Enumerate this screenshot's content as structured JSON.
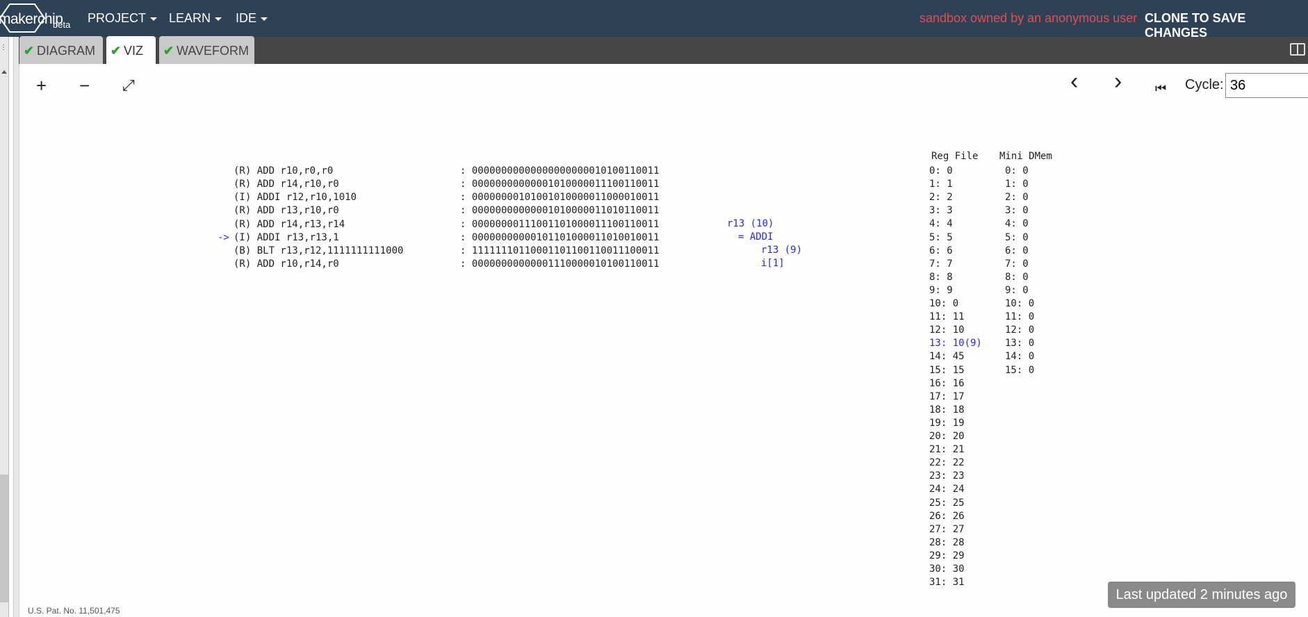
{
  "topbar": {
    "logo_text": "makerchip",
    "beta": "beta",
    "menus": [
      "PROJECT",
      "LEARN",
      "IDE"
    ],
    "sandbox_notice": "sandbox owned by an anonymous user",
    "clone_button": "CLONE TO SAVE CHANGES"
  },
  "tabs": [
    {
      "label": "DIAGRAM",
      "checked": true,
      "active": false
    },
    {
      "label": "VIZ",
      "checked": true,
      "active": true
    },
    {
      "label": "WAVEFORM",
      "checked": true,
      "active": false
    }
  ],
  "toolbar": {
    "zoom_in": "+",
    "zoom_out": "−",
    "fit": "⤢",
    "prev": "‹",
    "next": "›",
    "first": "⏮",
    "cycle_label": "Cycle:",
    "cycle_value": "36"
  },
  "viz": {
    "pc_arrow": "->",
    "instructions": [
      {
        "asm": "(R) ADD r10,r0,r0",
        "bits": ": 00000000000000000000010100110011"
      },
      {
        "asm": "(R) ADD r14,r10,r0",
        "bits": ": 00000000000001010000011100110011"
      },
      {
        "asm": "(I) ADDI r12,r10,1010",
        "bits": ": 00000000101001010000011000010011"
      },
      {
        "asm": "(R) ADD r13,r10,r0",
        "bits": ": 00000000000001010000011010110011"
      },
      {
        "asm": "(R) ADD r14,r13,r14",
        "bits": ": 00000000111001101000011100110011"
      },
      {
        "asm": "(I) ADDI r13,r13,1",
        "bits": ": 00000000000101101000011010010011"
      },
      {
        "asm": "(B) BLT r13,r12,1111111111000",
        "bits": ": 11111110110001101100110011100011"
      },
      {
        "asm": "(R) ADD r10,r14,r0",
        "bits": ": 00000000000001110000010100110011"
      }
    ],
    "explain": [
      "r13 (10)",
      "= ADDI",
      "r13 (9)",
      "i[1]"
    ],
    "reg_file_header": "Reg File",
    "mem_header": "Mini DMem",
    "registers": [
      "0: 0",
      "1: 1",
      "2: 2",
      "3: 3",
      "4: 4",
      "5: 5",
      "6: 6",
      "7: 7",
      "8: 8",
      "9: 9",
      "10: 0",
      "11: 11",
      "12: 10",
      "13: 10(9)",
      "14: 45",
      "15: 15",
      "16: 16",
      "17: 17",
      "18: 18",
      "19: 19",
      "20: 20",
      "21: 21",
      "22: 22",
      "23: 23",
      "24: 24",
      "25: 25",
      "26: 26",
      "27: 27",
      "28: 28",
      "29: 29",
      "30: 30",
      "31: 31"
    ],
    "highlighted_register": 13,
    "memory": [
      "0: 0",
      "1: 0",
      "2: 0",
      "3: 0",
      "4: 0",
      "5: 0",
      "6: 0",
      "7: 0",
      "8: 0",
      "9: 0",
      "10: 0",
      "11: 0",
      "12: 0",
      "13: 0",
      "14: 0",
      "15: 0"
    ]
  },
  "footer": {
    "patent": "U.S. Pat. No. 11,501,475",
    "toast": "Last updated 2 minutes ago"
  },
  "colors": {
    "topbar": "#2e4257",
    "sandbox": "#e94a4a",
    "check": "#27a427",
    "highlight": "#2b2bdc"
  }
}
